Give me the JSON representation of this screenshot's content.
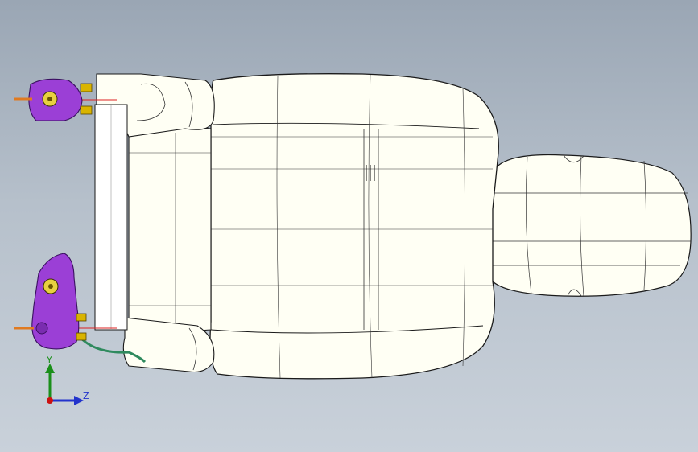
{
  "viewport": {
    "background_top": "#9aa6b4",
    "background_bottom": "#c9d1da"
  },
  "model": {
    "part_color": "#fffff4",
    "edge_color": "#1a1a1a",
    "bracket_color": "#9b3fd6",
    "bolt_color": "#d9b400",
    "pin_color": "#e07a20",
    "wire_color": "#2f8a5e"
  },
  "triad": {
    "y_label": "Y",
    "z_label": "Z",
    "y_color": "#1a8f1a",
    "z_color": "#2233cc",
    "origin_color": "#cc1111"
  }
}
